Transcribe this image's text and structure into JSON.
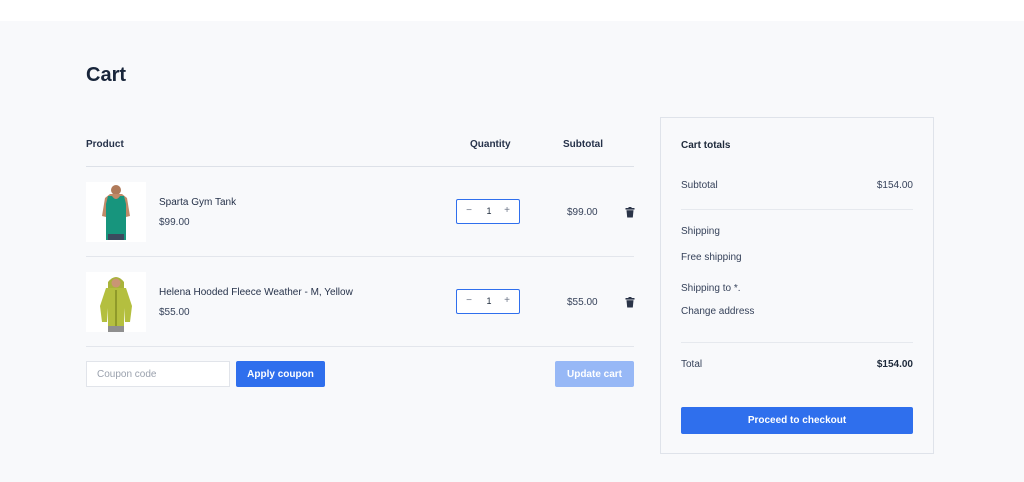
{
  "page": {
    "title": "Cart"
  },
  "table": {
    "headers": {
      "product": "Product",
      "quantity": "Quantity",
      "subtotal": "Subtotal"
    },
    "items": [
      {
        "name": "Sparta Gym Tank",
        "price": "$99.00",
        "quantity": "1",
        "subtotal": "$99.00",
        "image_icon": "green-tank-top-image"
      },
      {
        "name": "Helena Hooded Fleece Weather - M, Yellow",
        "price": "$55.00",
        "quantity": "1",
        "subtotal": "$55.00",
        "image_icon": "yellow-hoodie-image"
      }
    ],
    "stepper": {
      "minus": "−",
      "plus": "+"
    }
  },
  "coupon": {
    "placeholder": "Coupon code",
    "apply_label": "Apply coupon"
  },
  "update_label": "Update cart",
  "totals": {
    "title": "Cart totals",
    "subtotal_label": "Subtotal",
    "subtotal_value": "$154.00",
    "shipping_label": "Shipping",
    "shipping_method": "Free shipping",
    "shipping_to": "Shipping to *.",
    "change_address": "Change address",
    "total_label": "Total",
    "total_value": "$154.00",
    "checkout_label": "Proceed to checkout"
  },
  "colors": {
    "accent": "#2f6fed",
    "accent_disabled": "#97b8f6",
    "background": "#f8f9fb"
  }
}
